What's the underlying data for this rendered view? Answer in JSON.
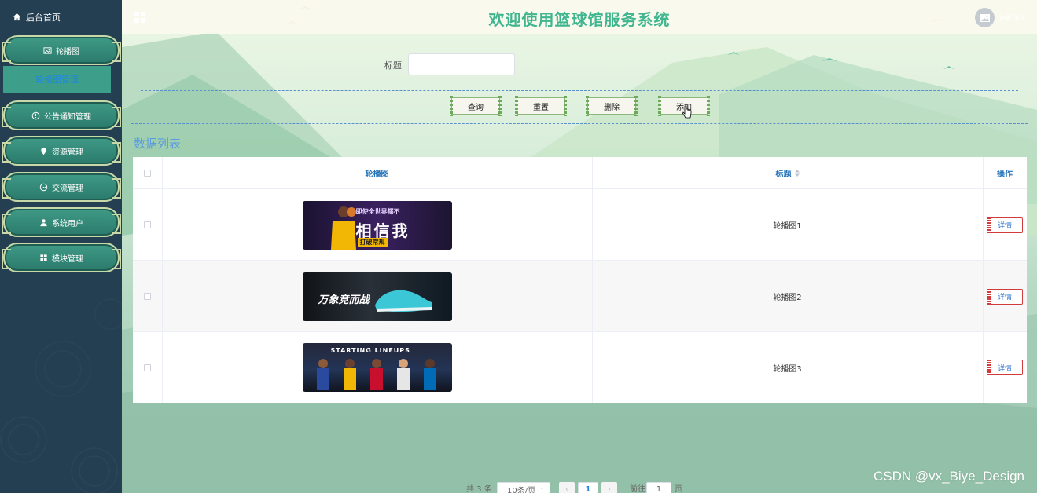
{
  "sidebar": {
    "home_label": "后台首页",
    "menu": [
      {
        "label": "轮播图",
        "icon": "image-icon"
      },
      {
        "label": "公告通知管理",
        "icon": "info-circle-icon"
      },
      {
        "label": "资源管理",
        "icon": "location-icon"
      },
      {
        "label": "交流管理",
        "icon": "chat-icon"
      },
      {
        "label": "系统用户",
        "icon": "user-icon"
      },
      {
        "label": "模块管理",
        "icon": "grid-icon"
      }
    ],
    "submenu_active": "轮播图管理"
  },
  "header": {
    "title": "欢迎使用篮球馆服务系统",
    "username": "admin"
  },
  "search": {
    "label": "标题",
    "value": "",
    "placeholder": ""
  },
  "actions": {
    "query": "查询",
    "reset": "重置",
    "delete": "删除",
    "add": "添加"
  },
  "list": {
    "title": "数据列表",
    "columns": [
      "轮播图",
      "标题",
      "操作"
    ],
    "rows": [
      {
        "title": "轮播图1",
        "banner_text": "相信我",
        "banner_subtext": "即使全世界都不",
        "banner_tag": "打破常规",
        "action": "详情"
      },
      {
        "title": "轮播图2",
        "banner_text": "万象竞而战",
        "action": "详情"
      },
      {
        "title": "轮播图3",
        "banner_text": "STARTING LINEUPS",
        "action": "详情"
      }
    ]
  },
  "pagination": {
    "total": "共 3 条",
    "page_size": "10条/页",
    "current_page": "1",
    "goto_label": "前往",
    "goto_value": "1",
    "page_unit": "页"
  },
  "watermark": "CSDN @vx_Biye_Design",
  "colors": {
    "sidebar_bg": "#243f52",
    "menu_green": "#3f9a86",
    "title_green": "#3fb68f",
    "header_blue": "#1e6fb8",
    "list_title_blue": "#5a9be0"
  }
}
